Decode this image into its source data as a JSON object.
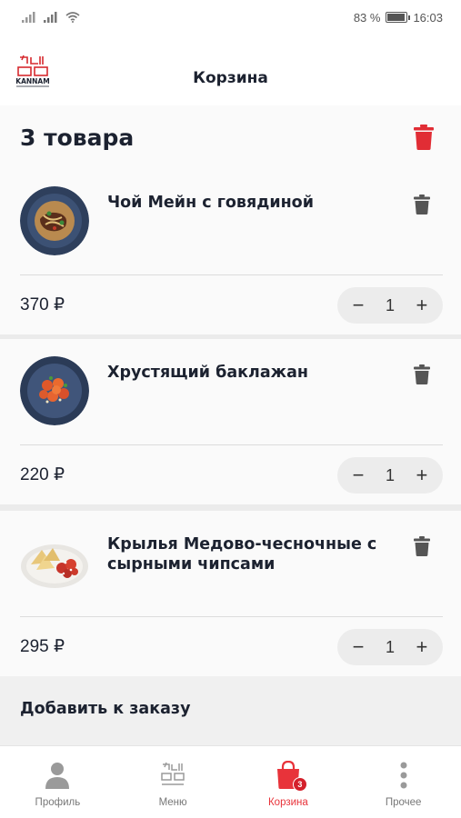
{
  "status_bar": {
    "battery": "83 %",
    "battery_level": 0.83,
    "time": "16:03"
  },
  "header": {
    "title": "Корзина",
    "logo_text": "KANNAM"
  },
  "cart": {
    "count_label": "3 товара",
    "items": [
      {
        "name": "Чой Мейн с говядиной",
        "price": "370 ₽",
        "quantity": "1"
      },
      {
        "name": "Хрустящий баклажан",
        "price": "220 ₽",
        "quantity": "1"
      },
      {
        "name": "Крылья Медово-чесночные с сырными чипсами",
        "price": "295 ₽",
        "quantity": "1"
      }
    ]
  },
  "stepper": {
    "minus": "−",
    "plus": "+"
  },
  "add_section": {
    "title": "Добавить к заказу"
  },
  "tabs": [
    {
      "label": "Профиль",
      "icon": "profile-icon"
    },
    {
      "label": "Меню",
      "icon": "menu-logo-icon"
    },
    {
      "label": "Корзина",
      "icon": "cart-bag-icon",
      "badge": "3",
      "active": true
    },
    {
      "label": "Прочее",
      "icon": "more-icon"
    }
  ],
  "colors": {
    "accent": "#e8333a",
    "text": "#1c2230",
    "trash": "#e12d35"
  }
}
